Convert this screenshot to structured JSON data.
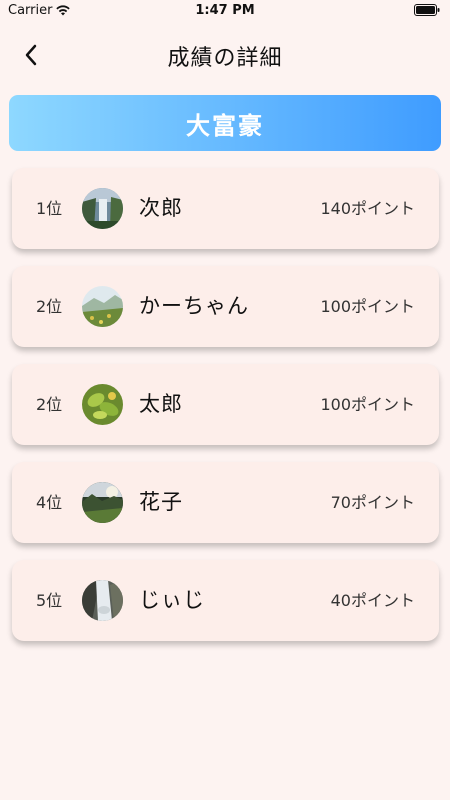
{
  "status_bar": {
    "carrier": "Carrier",
    "time": "1:47 PM"
  },
  "nav": {
    "title": "成績の詳細",
    "back_icon": "chevron-left-icon"
  },
  "banner": {
    "label": "大富豪",
    "gradient": [
      "#8ed8ff",
      "#3f9cff"
    ]
  },
  "rankings": [
    {
      "rank": "1位",
      "name": "次郎",
      "points": "140ポイント",
      "avatar": "waterfall-photo"
    },
    {
      "rank": "2位",
      "name": "かーちゃん",
      "points": "100ポイント",
      "avatar": "mountain-meadow-photo"
    },
    {
      "rank": "2位",
      "name": "太郎",
      "points": "100ポイント",
      "avatar": "green-leaves-photo"
    },
    {
      "rank": "4位",
      "name": "花子",
      "points": "70ポイント",
      "avatar": "forest-sunset-photo"
    },
    {
      "rank": "5位",
      "name": "じぃじ",
      "points": "40ポイント",
      "avatar": "river-rocks-photo"
    }
  ]
}
